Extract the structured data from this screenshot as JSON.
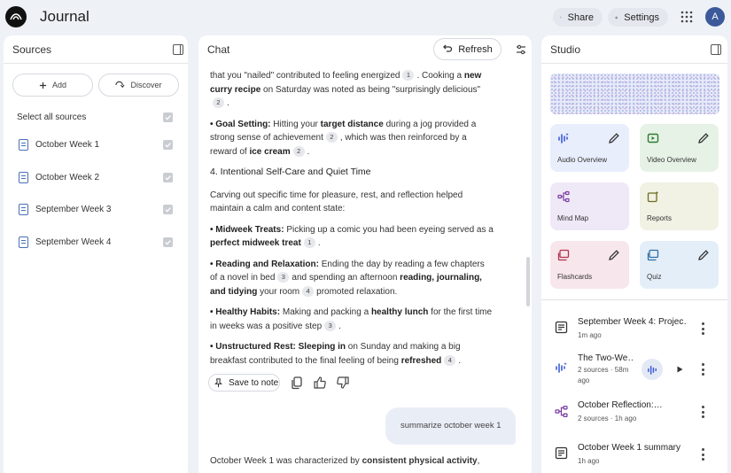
{
  "app": {
    "title": "Journal",
    "avatar_letter": "A"
  },
  "topbar": {
    "share_label": "Share",
    "settings_label": "Settings"
  },
  "sources": {
    "title": "Sources",
    "add_label": "Add",
    "discover_label": "Discover",
    "select_all_label": "Select all sources",
    "items": [
      {
        "label": "October Week 1"
      },
      {
        "label": "October Week 2"
      },
      {
        "label": "September Week 3"
      },
      {
        "label": "September Week 4"
      }
    ]
  },
  "chat": {
    "title": "Chat",
    "refresh_label": "Refresh",
    "p1": {
      "a": "that you \"nailed\" contributed to feeling energized",
      "c1": "1",
      "b": ". Cooking a",
      "bold": "new curry recipe",
      "d": "on Saturday was noted as being \"surprisingly delicious\"",
      "c2": "2",
      "e": "."
    },
    "p2": {
      "bullet": "• ",
      "bold1": "Goal Setting:",
      "a": "Hitting your",
      "bold2": "target distance",
      "b": "during a jog provided a strong sense of achievement",
      "c1": "2",
      "c": ", which was then reinforced by a reward of",
      "bold3": "ice cream",
      "c2": "2",
      "d": "."
    },
    "heading": "4. Intentional Self-Care and Quiet Time",
    "p3": "Carving out specific time for pleasure, rest, and reflection helped maintain a calm and content state:",
    "p4": {
      "bullet": "• ",
      "bold1": "Midweek Treats:",
      "a": "Picking up a comic you had been eyeing served as a",
      "bold2": "perfect midweek treat",
      "c1": "1",
      "b": "."
    },
    "p5": {
      "bullet": "• ",
      "bold1": "Reading and Relaxation:",
      "a": "Ending the day by reading a few chapters of a novel in bed",
      "c1": "3",
      "b": "and spending an afternoon",
      "bold2": "reading, journaling, and tidying",
      "c": "your room",
      "c2": "4",
      "d": "promoted relaxation."
    },
    "p6": {
      "bullet": "• ",
      "bold1": "Healthy Habits:",
      "a": "Making and packing a",
      "bold2": "healthy lunch",
      "b": "for the first time in weeks was a positive step",
      "c1": "3",
      "c": "."
    },
    "p7": {
      "bullet": "• ",
      "bold1": "Unstructured Rest:",
      "bold2": "Sleeping in",
      "a": "on Sunday and making a big breakfast contributed to the final feeling of being",
      "bold3": "refreshed",
      "c1": "4",
      "b": "."
    },
    "save_note_label": "Save to note",
    "user_message": "summarize october week 1",
    "reply_start": "October Week 1 was characterized by",
    "reply_bold": "consistent physical activity",
    "reply_end": ","
  },
  "studio": {
    "title": "Studio",
    "tiles": [
      {
        "label": "Audio Overview"
      },
      {
        "label": "Video Overview"
      },
      {
        "label": "Mind Map"
      },
      {
        "label": "Reports"
      },
      {
        "label": "Flashcards"
      },
      {
        "label": "Quiz"
      }
    ],
    "notes": [
      {
        "title": "September Week 4: Projec…",
        "meta": "1m ago"
      },
      {
        "title": "The Two-We…",
        "meta": "2 sources · 58m ago"
      },
      {
        "title": "October Reflection:…",
        "meta": "2 sources · 1h ago"
      },
      {
        "title": "October Week 1 summary",
        "meta": "1h ago"
      }
    ]
  },
  "colors": {
    "accent": "#4a6fb5",
    "audio_icon": "#3d5bd6",
    "video_icon": "#2e7d32",
    "mindmap_icon": "#7b3fa0",
    "reports_icon": "#6d6d1f",
    "flashcards_icon": "#b0344c",
    "quiz_icon": "#2f6fa8"
  }
}
